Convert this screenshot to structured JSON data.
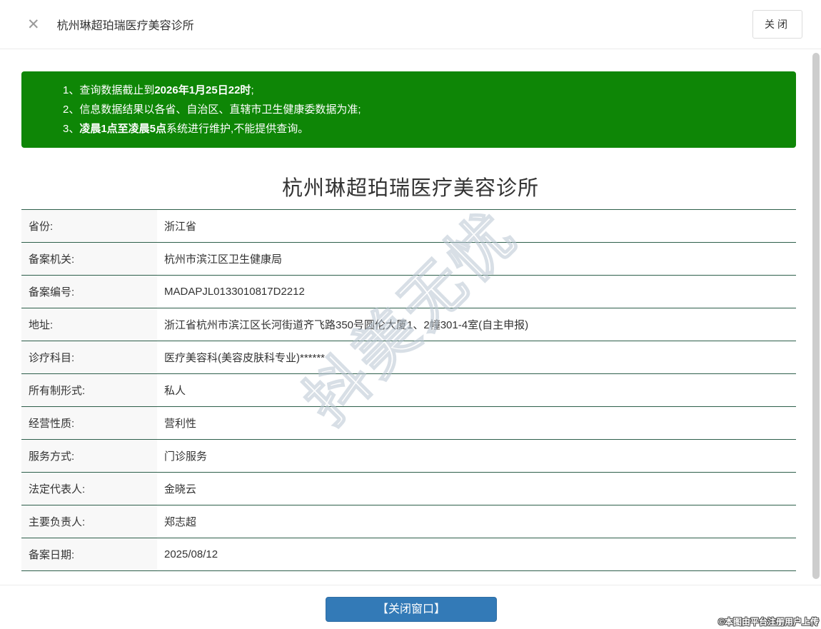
{
  "header": {
    "close_icon": "✕",
    "title": "杭州琳超珀瑞医疗美容诊所",
    "close_button_label": "关闭"
  },
  "notice": {
    "lines": [
      {
        "segments": [
          {
            "text": "1、查询数据截止到",
            "bold": false
          },
          {
            "text": "2026年1月25日22时",
            "bold": true
          },
          {
            "text": ";",
            "bold": false
          }
        ]
      },
      {
        "segments": [
          {
            "text": "2、信息数据结果以各省、自治区、直辖市卫生健康委数据为准;",
            "bold": false
          }
        ]
      },
      {
        "segments": [
          {
            "text": "3、",
            "bold": false
          },
          {
            "text": "凌晨1点至凌晨5点",
            "bold": true
          },
          {
            "text": "系统进行维护,不能提供查询。",
            "bold": false
          }
        ]
      }
    ]
  },
  "main": {
    "title": "杭州琳超珀瑞医疗美容诊所",
    "fields": [
      {
        "label": "省份:",
        "value": "浙江省"
      },
      {
        "label": "备案机关:",
        "value": "杭州市滨江区卫生健康局"
      },
      {
        "label": "备案编号:",
        "value": "MADAPJL0133010817D2212"
      },
      {
        "label": "地址:",
        "value": "浙江省杭州市滨江区长河街道齐飞路350号圆伦大厦1、2幢301-4室(自主申报)"
      },
      {
        "label": "诊疗科目:",
        "value": "医疗美容科(美容皮肤科专业)******"
      },
      {
        "label": "所有制形式:",
        "value": "私人"
      },
      {
        "label": "经营性质:",
        "value": "营利性"
      },
      {
        "label": "服务方式:",
        "value": "门诊服务"
      },
      {
        "label": "法定代表人:",
        "value": "金晓云"
      },
      {
        "label": "主要负责人:",
        "value": "郑志超"
      },
      {
        "label": "备案日期:",
        "value": "2025/08/12"
      }
    ]
  },
  "watermark": "抖美无忧",
  "footer": {
    "close_window_button": "【关闭窗口】",
    "credit": "©本图由平台注册用户上传"
  },
  "colors": {
    "notice_green": "#0e8606",
    "divider_green": "#2e5f4b",
    "button_blue": "#337ab7"
  }
}
